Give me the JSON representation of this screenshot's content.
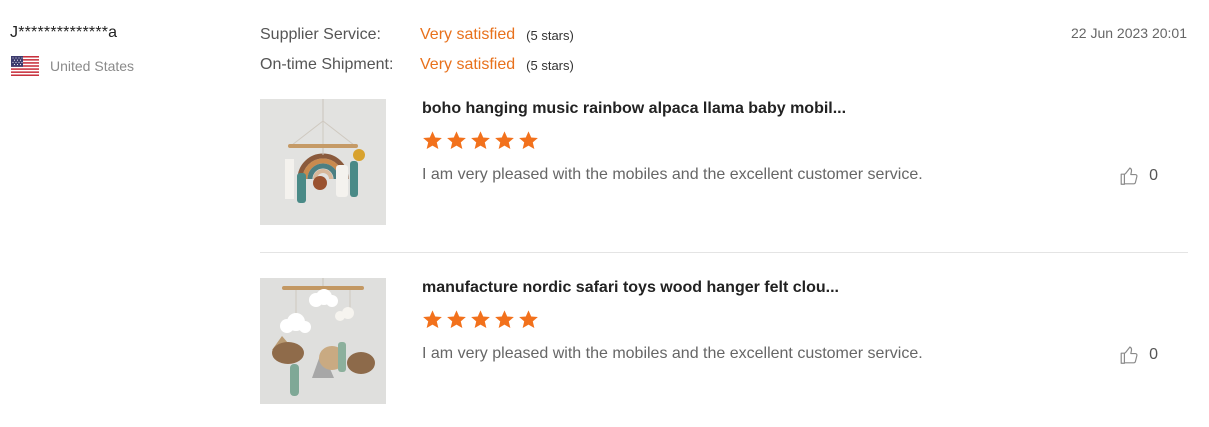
{
  "reviewer": {
    "name": "J**************a",
    "country": "United States"
  },
  "ratings": [
    {
      "label": "Supplier Service:",
      "value": "Very satisfied",
      "stars_text": "(5 stars)"
    },
    {
      "label": "On-time Shipment:",
      "value": "Very satisfied",
      "stars_text": "(5 stars)"
    }
  ],
  "date": "22 Jun 2023 20:01",
  "products": [
    {
      "title": "boho hanging music rainbow alpaca llama baby mobil...",
      "rating": 5,
      "comment": "I am very pleased with the mobiles and the excellent customer service.",
      "likes": "0"
    },
    {
      "title": "manufacture nordic safari toys wood hanger felt clou...",
      "rating": 5,
      "comment": "I am very pleased with the mobiles and the excellent customer service.",
      "likes": "0"
    }
  ],
  "colors": {
    "accent": "#e8711c",
    "star": "#f2711c",
    "divider": "#e4e4e4"
  },
  "icons": {
    "flag": "us-flag-icon",
    "star": "star-icon",
    "like": "thumbs-up-icon"
  }
}
